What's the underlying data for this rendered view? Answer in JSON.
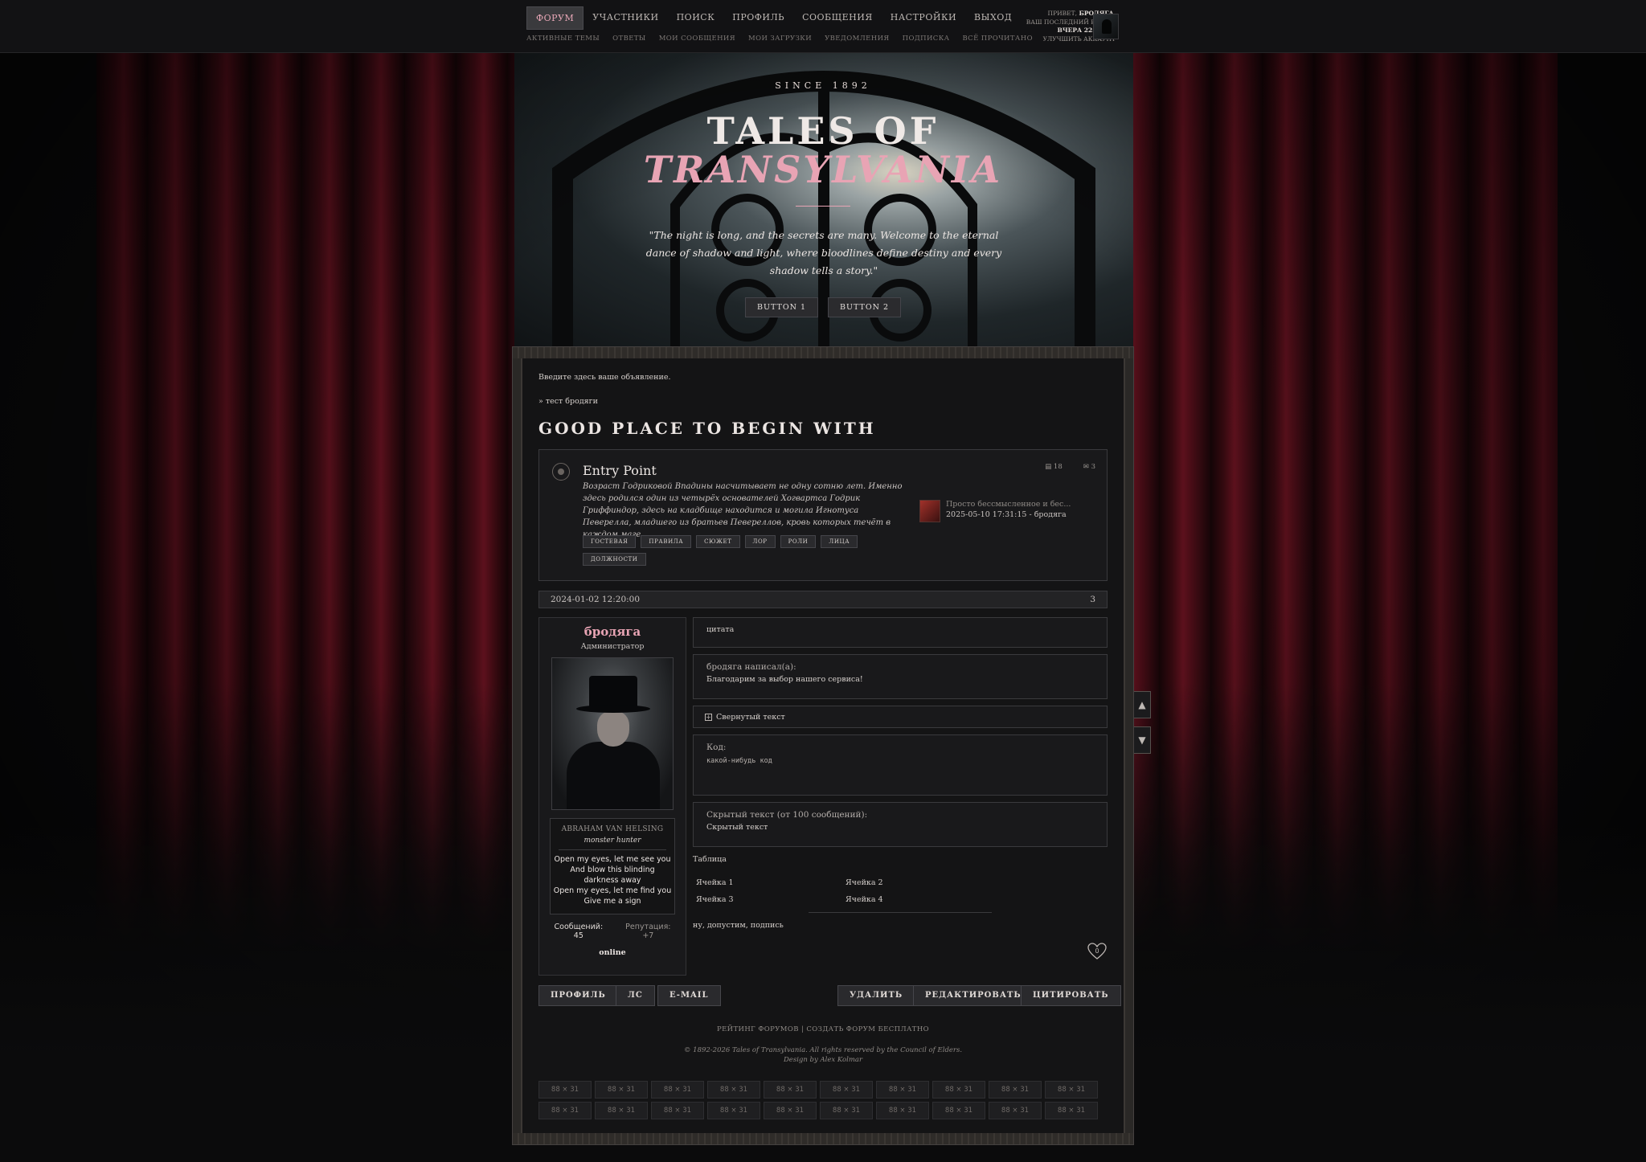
{
  "nav": {
    "main": [
      "Форум",
      "Участники",
      "Поиск",
      "Профиль",
      "Сообщения",
      "Настройки",
      "Выход"
    ],
    "sub": [
      "Активные темы",
      "Ответы",
      "Мои сообщения",
      "Мои загрузки",
      "Уведомления",
      "Подписка",
      "Всё прочитано"
    ]
  },
  "user": {
    "greeting": "Привет,",
    "name": "бродяга",
    "last_visit_label": "Ваш последний визит:",
    "last_visit": "Вчера 22:09:23",
    "upgrade": "Улучшить аккаунт"
  },
  "hero": {
    "since": "SINCE 1892",
    "title_line1": "TALES OF",
    "title_line2": "TRANSYLVANIA",
    "quote": "\"The night is long, and the secrets are many. Welcome to the eternal dance of shadow and light, where bloodlines define destiny and every shadow tells a story.\"",
    "button1": "BUTTON 1",
    "button2": "BUTTON 2"
  },
  "content": {
    "announcement": "Введите здесь ваше объявление.",
    "breadcrumb": "» тест бродяги",
    "section_title": "GOOD PLACE TO BEGIN WITH"
  },
  "forum": {
    "name": "Entry Point",
    "description": "Возраст Годриковой Впадины насчитывает не одну сотню лет. Именно здесь родился один из четырёх основателей Хогвартса Годрик Гриффиндор, здесь на кладбище находится и могила Игнотуса Певерелла, младшего из братьев Певереллов, кровь которых течёт в каждом маге.",
    "topics_count": "18",
    "posts_count": "3",
    "last_post_title": "Просто бессмысленное и бес...",
    "last_post_meta": "2025-05-10 17:31:15 - бродяга",
    "tags": [
      "Гостевая",
      "Правила",
      "Сюжет",
      "Лор",
      "Роли",
      "Лица",
      "Должности"
    ]
  },
  "post": {
    "date": "2024-01-02 12:20:00",
    "number": "3",
    "author": {
      "name": "бродяга",
      "role": "Администратор",
      "char_name": "Abraham Van Helsing",
      "char_title": "monster hunter",
      "lyrics": [
        "Open my eyes, let me see you",
        "And blow this blinding",
        "darkness away",
        "Open my eyes, let me find you",
        "Give me a sign"
      ],
      "messages_label": "Сообщений:",
      "messages": "45",
      "reputation_label": "Репутация:",
      "reputation": "+7",
      "status": "online"
    },
    "quote_text": "цитата",
    "quote2_header": "бродяга написал(а):",
    "quote2_body": "Благодарим за выбор нашего сервиса!",
    "spoiler": "Свернутый текст",
    "code_header": "Код:",
    "code_body": "какой-нибудь код",
    "hidden_header": "Скрытый текст (от 100 сообщений):",
    "hidden_body": "Скрытый текст",
    "table_label": "Таблица",
    "table": [
      [
        "Ячейка 1",
        "Ячейка 2"
      ],
      [
        "Ячейка 3",
        "Ячейка 4"
      ]
    ],
    "signature": "ну, допустим, подпись",
    "likes": "0"
  },
  "actions": {
    "profile": "Профиль",
    "pm": "ЛС",
    "email": "E-mail",
    "delete": "Удалить",
    "edit": "Редактировать",
    "quote": "Цитировать"
  },
  "footer": {
    "links": "Рейтинг форумов | Создать форум бесплатно",
    "copyright": "© 1892-2026 Tales of Transylvania. All rights reserved by the Council of Elders.",
    "design": "Design by Alex Kolmar",
    "banner_label": "88 × 31"
  },
  "colors": {
    "accent": "#e8a4b4",
    "panel": "#141415",
    "curtain": "#6b1220"
  }
}
